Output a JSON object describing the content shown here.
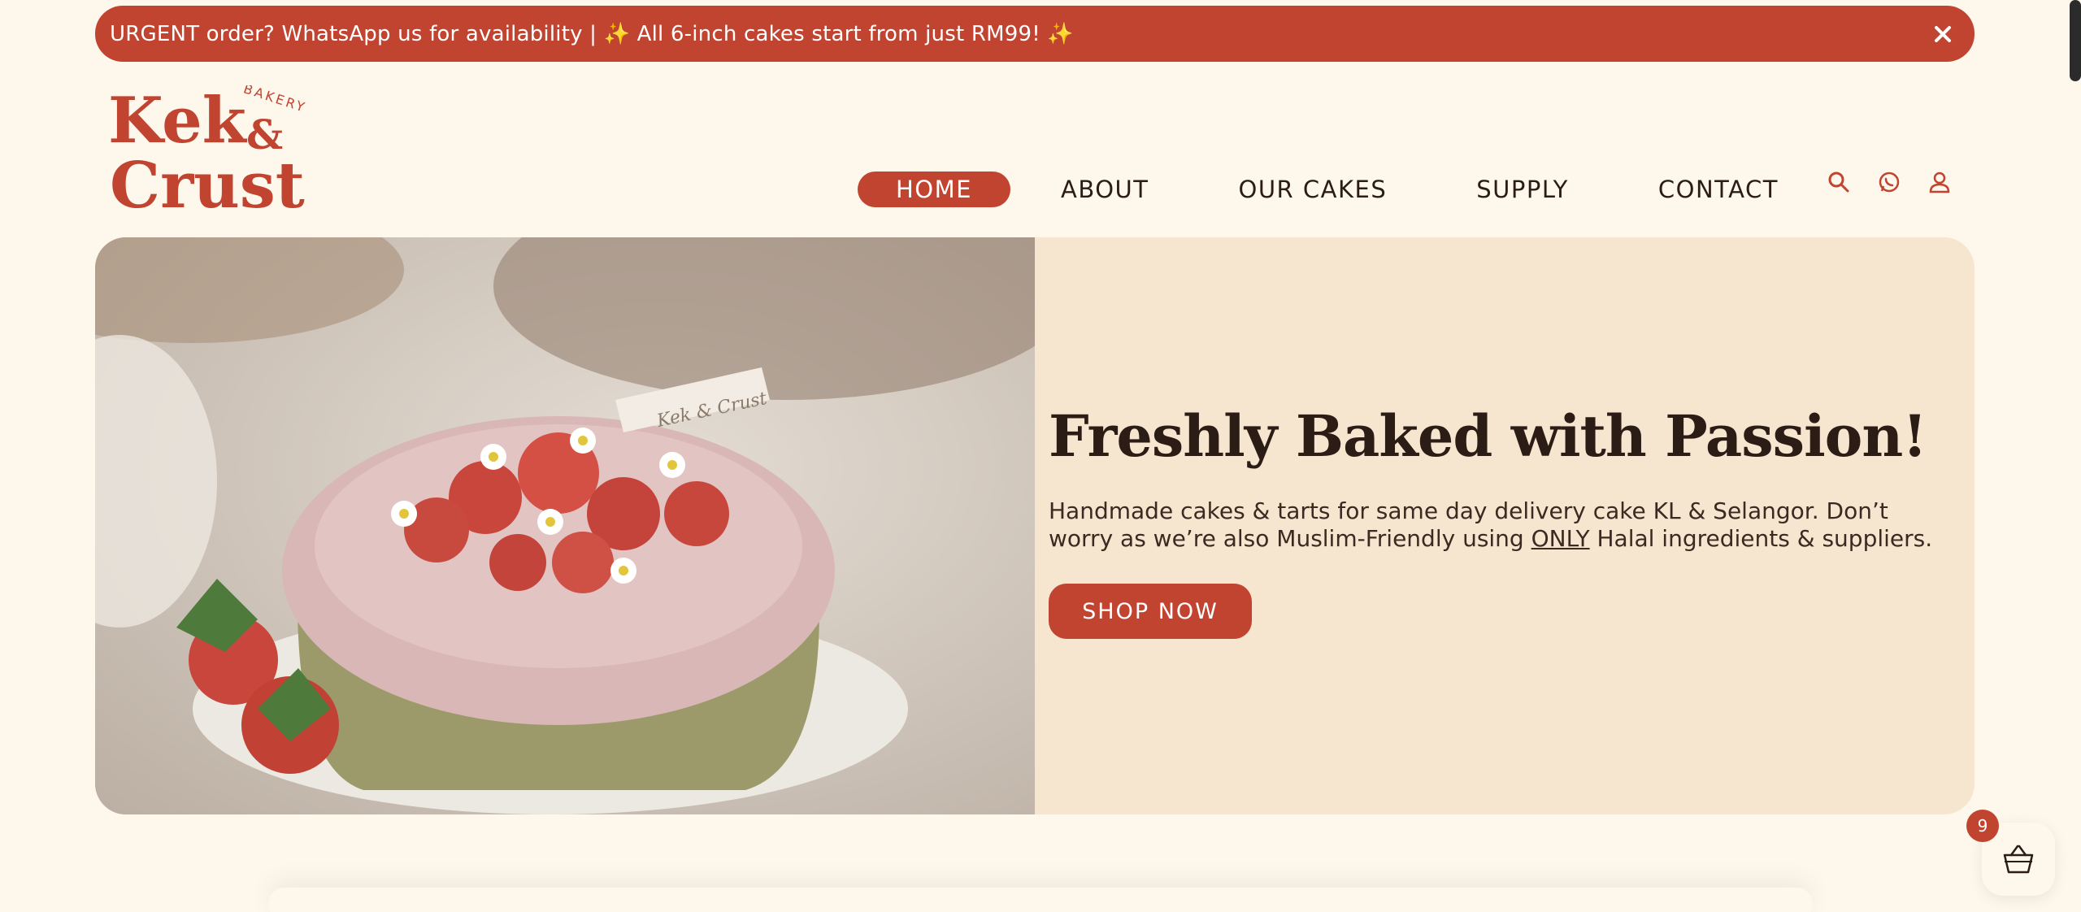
{
  "announcement": {
    "text": "URGENT order? WhatsApp us for availability | ✨ All 6-inch cakes start from just RM99! ✨",
    "close_icon": "close-icon"
  },
  "brand": {
    "logo_line1": "Kek",
    "logo_amp": "&",
    "logo_line2": "Crust",
    "logo_tag": "BAKERY"
  },
  "nav": {
    "items": [
      {
        "label": "HOME",
        "active": true
      },
      {
        "label": "ABOUT",
        "active": false
      },
      {
        "label": "OUR CAKES",
        "active": false
      },
      {
        "label": "SUPPLY",
        "active": false
      },
      {
        "label": "CONTACT",
        "active": false
      }
    ],
    "icons": [
      "search-icon",
      "whatsapp-icon",
      "account-icon"
    ]
  },
  "hero": {
    "headline": "Freshly Baked with Passion!",
    "description_before": "Handmade cakes & tarts for same day delivery cake KL & Selangor. Don’t worry as we’re also Muslim-Friendly using ",
    "description_emphasis": "ONLY",
    "description_after": " Halal ingredients & suppliers.",
    "cta_label": "SHOP NOW",
    "image_alt": "Strawberry cake with pink frosting and daisy flowers",
    "image_tag_text": "Kek & Crust"
  },
  "cart": {
    "count": "9",
    "icon": "basket-icon"
  },
  "colors": {
    "accent": "#c14431",
    "background": "#fdf7ec",
    "hero_panel": "#f6e5cf",
    "text": "#2b1d16"
  }
}
